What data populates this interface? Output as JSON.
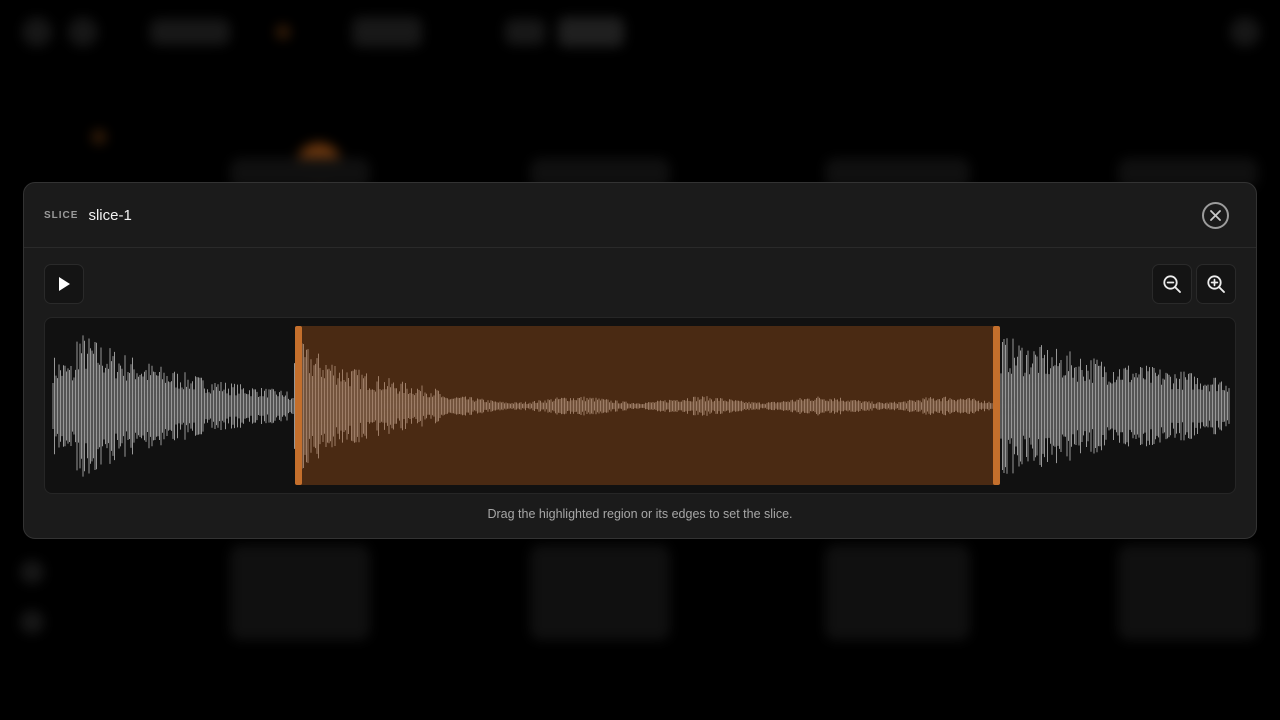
{
  "modal": {
    "kicker": "SLICE",
    "title": "slice-1",
    "hint": "Drag the highlighted region or its edges to set the slice."
  },
  "icons": {
    "close": "close-icon",
    "play": "play-icon",
    "zoom_out": "zoom-out-icon",
    "zoom_in": "zoom-in-icon"
  },
  "slice": {
    "start": 0.206,
    "end": 0.805
  },
  "colors": {
    "accent": "#c46f2c",
    "region_fill": "#3a2517",
    "waveform": "#a8a8a8",
    "modal_bg": "#1b1b1b"
  }
}
